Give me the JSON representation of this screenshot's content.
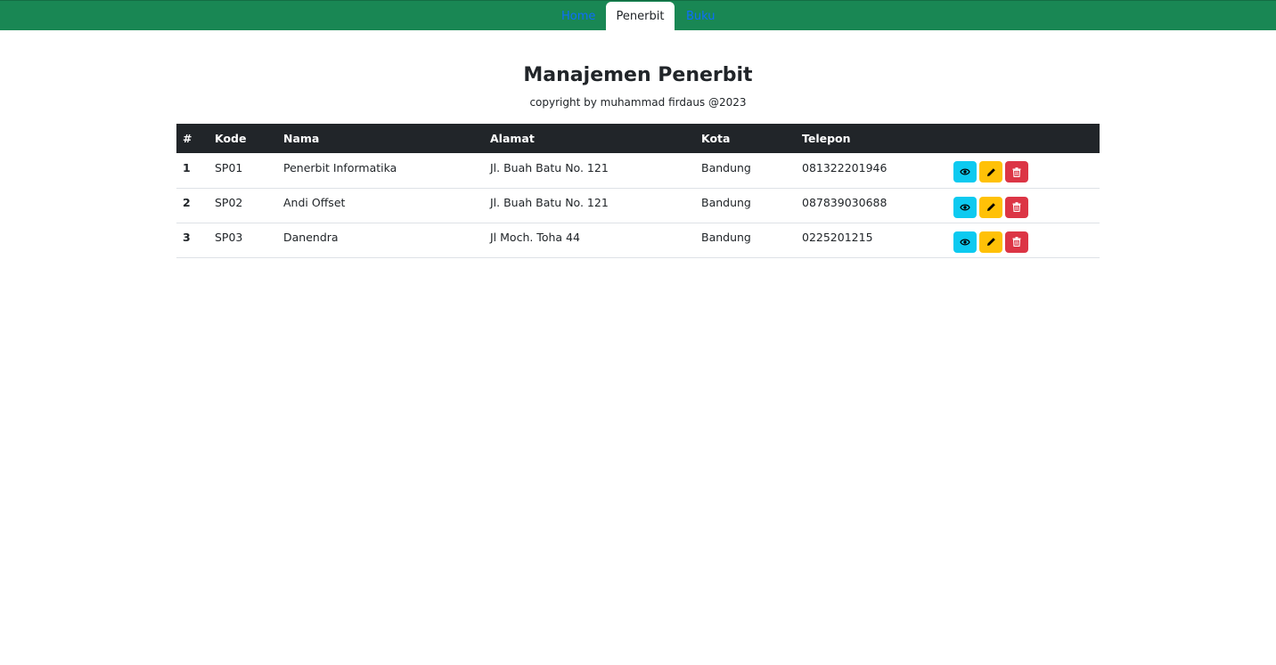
{
  "nav": {
    "tabs": [
      {
        "label": "Home"
      },
      {
        "label": "Penerbit"
      },
      {
        "label": "Buku"
      }
    ]
  },
  "page": {
    "title": "Manajemen Penerbit",
    "subtitle": "copyright by muhammad firdaus @2023"
  },
  "table": {
    "headers": [
      "#",
      "Kode",
      "Nama",
      "Alamat",
      "Kota",
      "Telepon"
    ],
    "rows": [
      {
        "no": "1",
        "kode": "SP01",
        "nama": "Penerbit Informatika",
        "alamat": "Jl. Buah Batu No. 121",
        "kota": "Bandung",
        "telepon": "081322201946"
      },
      {
        "no": "2",
        "kode": "SP02",
        "nama": "Andi Offset",
        "alamat": "Jl. Buah Batu No. 121",
        "kota": "Bandung",
        "telepon": "087839030688"
      },
      {
        "no": "3",
        "kode": "SP03",
        "nama": "Danendra",
        "alamat": "Jl Moch. Toha 44",
        "kota": "Bandung",
        "telepon": "0225201215"
      }
    ],
    "action_icons": [
      "eye-icon",
      "pencil-icon",
      "trash-icon"
    ]
  },
  "colors": {
    "navbar": "#198754",
    "header": "#212529",
    "view": "#0dcaf0",
    "edit": "#ffc107",
    "delete": "#dc3545",
    "link": "#0d6efd"
  }
}
